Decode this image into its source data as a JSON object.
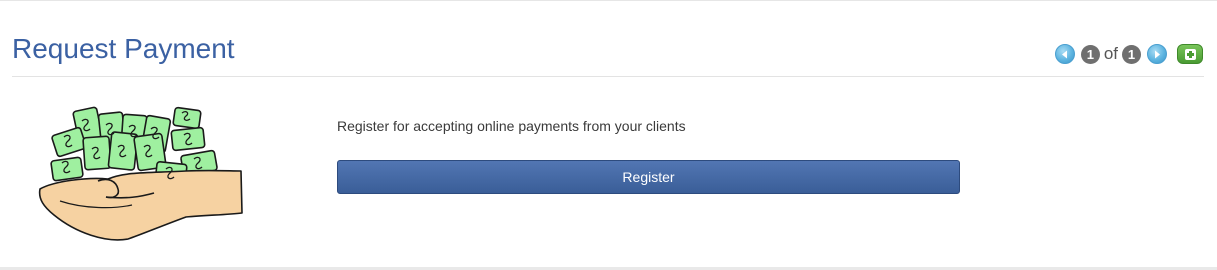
{
  "header": {
    "title": "Request Payment"
  },
  "pager": {
    "current": "1",
    "separator": "of",
    "total": "1",
    "prev_icon": "prev-arrow-icon",
    "next_icon": "next-arrow-icon",
    "add_icon": "plus-icon"
  },
  "main": {
    "illustration": "money-in-hand-illustration",
    "description": "Register for accepting online payments from your clients",
    "register_label": "Register"
  },
  "colors": {
    "title": "#3b61a3",
    "button": "#46699f",
    "money": "#9ff0a0",
    "hand": "#f6d2a2",
    "add": "#5aae3e"
  }
}
